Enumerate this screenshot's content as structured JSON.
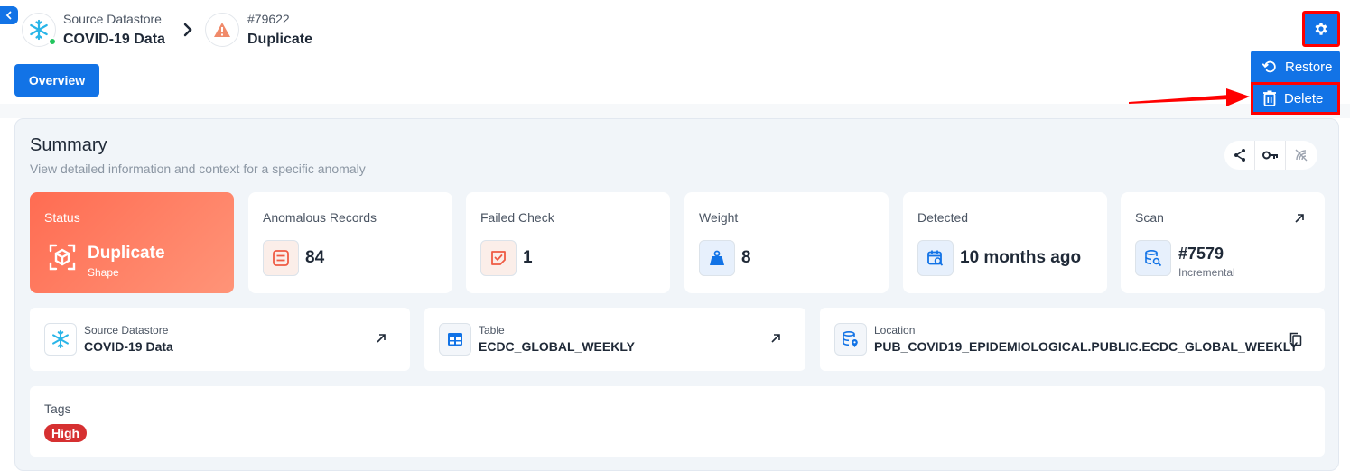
{
  "breadcrumb": {
    "datastore": {
      "label": "Source Datastore",
      "name": "COVID-19 Data",
      "icon": "snowflake-icon",
      "status_color": "#22c55e"
    },
    "anomaly": {
      "id": "#79622",
      "name": "Duplicate",
      "icon": "warning-icon"
    }
  },
  "tabs": {
    "overview": "Overview"
  },
  "menu": {
    "restore": "Restore",
    "delete": "Delete"
  },
  "summary": {
    "title": "Summary",
    "subtitle": "View detailed information and context for a specific anomaly"
  },
  "cards": {
    "status": {
      "label": "Status",
      "value": "Duplicate",
      "sub": "Shape"
    },
    "anomalous_records": {
      "label": "Anomalous Records",
      "value": "84"
    },
    "failed_check": {
      "label": "Failed Check",
      "value": "1"
    },
    "weight": {
      "label": "Weight",
      "value": "8"
    },
    "detected": {
      "label": "Detected",
      "value": "10 months ago"
    },
    "scan": {
      "label": "Scan",
      "value": "#7579",
      "sub": "Incremental"
    }
  },
  "info": {
    "datastore": {
      "label": "Source Datastore",
      "value": "COVID-19 Data"
    },
    "table": {
      "label": "Table",
      "value": "ECDC_GLOBAL_WEEKLY"
    },
    "location": {
      "label": "Location",
      "value": "PUB_COVID19_EPIDEMIOLOGICAL.PUBLIC.ECDC_GLOBAL_WEEKLY"
    }
  },
  "tags": {
    "label": "Tags",
    "items": [
      "High"
    ]
  },
  "colors": {
    "accent": "#1273e6",
    "status_gradient_start": "#ff6c52",
    "tag_high": "#d63031",
    "highlight_border": "#ff0000"
  }
}
